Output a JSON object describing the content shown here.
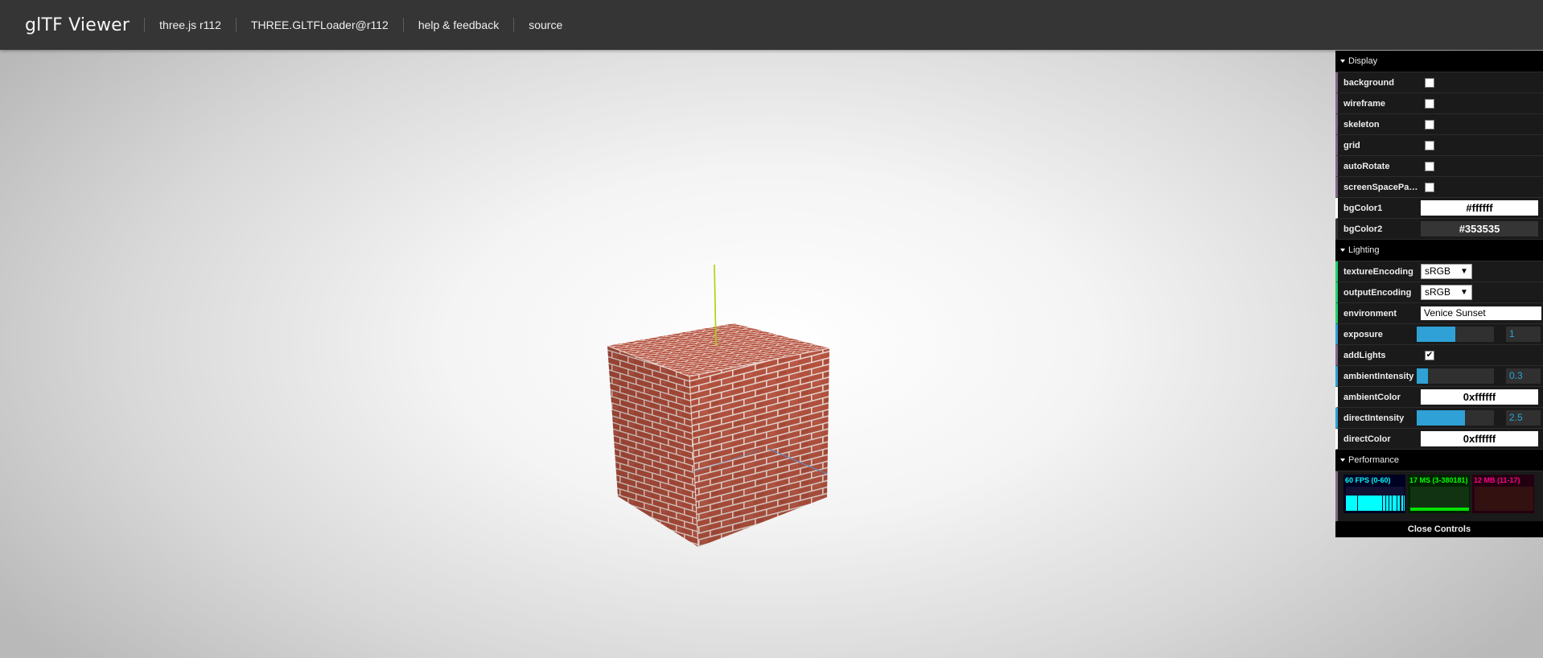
{
  "header": {
    "title": "glTF Viewer",
    "links": [
      "three.js r112",
      "THREE.GLTFLoader@r112",
      "help & feedback",
      "source"
    ]
  },
  "gui": {
    "display": {
      "title": "Display",
      "background": "background",
      "wireframe": "wireframe",
      "skeleton": "skeleton",
      "grid": "grid",
      "autoRotate": "autoRotate",
      "screenSpacePanning": "screenSpacePan…",
      "bgColor1_label": "bgColor1",
      "bgColor1_value": "#ffffff",
      "bgColor2_label": "bgColor2",
      "bgColor2_value": "#353535"
    },
    "lighting": {
      "title": "Lighting",
      "textureEncoding_label": "textureEncoding",
      "textureEncoding_value": "sRGB",
      "outputEncoding_label": "outputEncoding",
      "outputEncoding_value": "sRGB",
      "environment_label": "environment",
      "environment_value": "Venice Sunset",
      "exposure_label": "exposure",
      "exposure_value": "1",
      "exposure_fraction": 0.5,
      "addLights_label": "addLights",
      "addLights_checked": true,
      "ambientIntensity_label": "ambientIntensity",
      "ambientIntensity_value": "0.3",
      "ambientIntensity_fraction": 0.15,
      "ambientColor_label": "ambientColor",
      "ambientColor_value": "0xffffff",
      "directIntensity_label": "directIntensity",
      "directIntensity_value": "2.5",
      "directIntensity_fraction": 0.62,
      "directColor_label": "directColor",
      "directColor_value": "0xffffff"
    },
    "performance": {
      "title": "Performance",
      "fps": "60 FPS (0-60)",
      "ms": "17 MS (3-380181)",
      "mb": "12 MB (11-17)"
    },
    "close_label": "Close Controls"
  },
  "colors": {
    "header_bg": "#353535",
    "slider_accent": "#2fa1d6",
    "brick": "#b5523f"
  }
}
